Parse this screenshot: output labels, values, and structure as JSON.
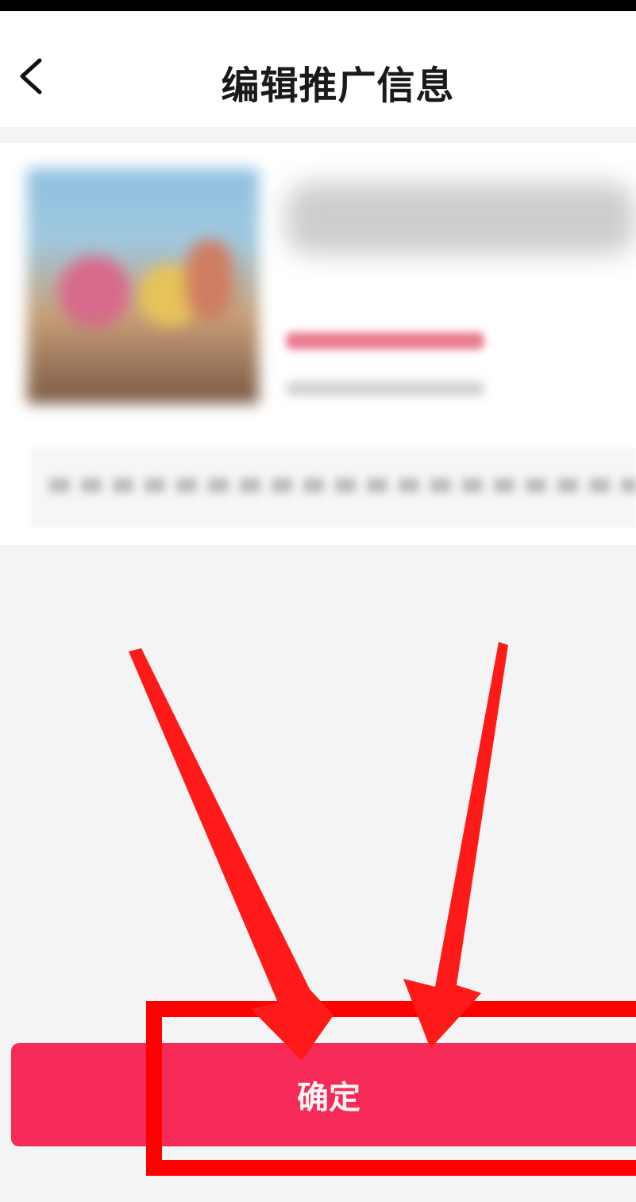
{
  "header": {
    "title": "编辑推广信息",
    "back_icon": "chevron-left-icon"
  },
  "card": {
    "product_image": "product-thumbnail",
    "title": "",
    "price": "",
    "subtitle": "",
    "description": ""
  },
  "footer": {
    "confirm_label": "确定"
  },
  "annotation": {
    "highlight_color": "#ff0000",
    "arrow_color": "#ff1a1a"
  },
  "colors": {
    "brand_button": "#f52a56",
    "background": "#f4f4f4"
  }
}
